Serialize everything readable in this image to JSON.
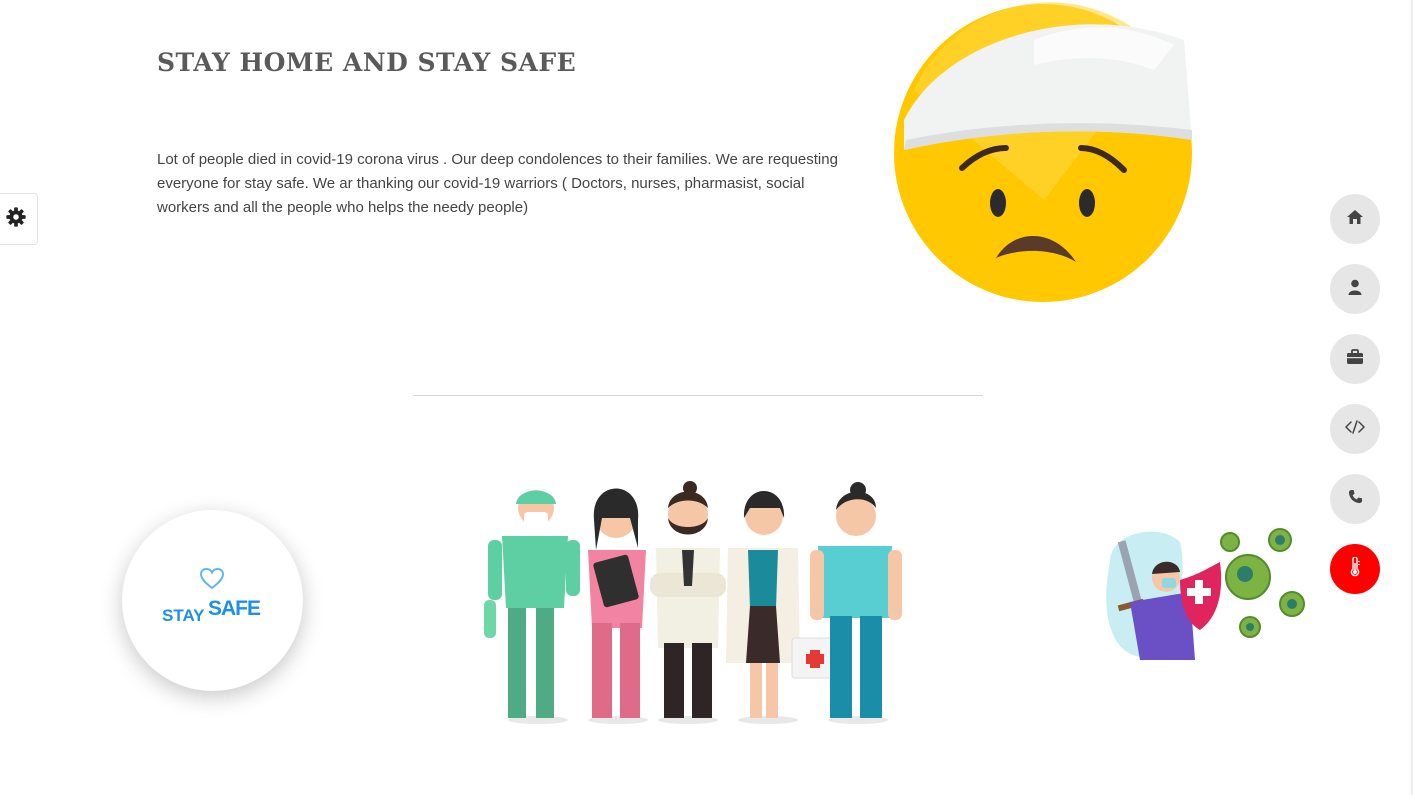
{
  "page": {
    "title": "STAY HOME AND STAY SAFE",
    "intro": "Lot of people died in covid-19 corona virus . Our deep condolences to their families. We are requesting everyone for stay safe. We ar thanking our covid-19 warriors ( Doctors, nurses, pharmasist, social workers and all the people who helps the needy people)"
  },
  "logo": {
    "stay": "STAY",
    "safe": "SAFE",
    "color": "#1e90e6"
  },
  "side_nav": {
    "items": [
      {
        "icon": "home-icon"
      },
      {
        "icon": "user-icon"
      },
      {
        "icon": "briefcase-icon"
      },
      {
        "icon": "code-icon"
      },
      {
        "icon": "phone-icon"
      },
      {
        "icon": "thermometer-icon",
        "active": true
      }
    ],
    "active_color": "#ff0000",
    "inactive_color": "#e6e6e6"
  },
  "settings": {
    "icon": "gear-icon"
  }
}
